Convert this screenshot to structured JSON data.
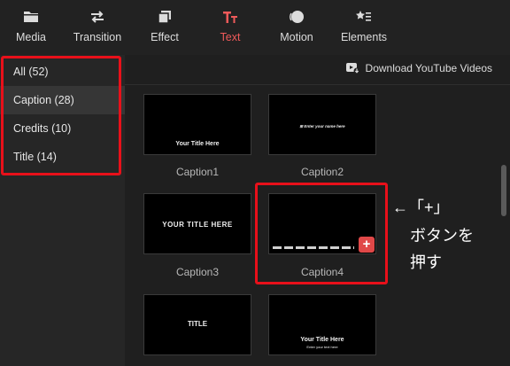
{
  "toolbar": {
    "items": [
      {
        "label": "Media",
        "icon": "folder-icon"
      },
      {
        "label": "Transition",
        "icon": "swap-arrows-icon"
      },
      {
        "label": "Effect",
        "icon": "layers-icon"
      },
      {
        "label": "Text",
        "icon": "text-icon",
        "active": true
      },
      {
        "label": "Motion",
        "icon": "motion-circle-icon"
      },
      {
        "label": "Elements",
        "icon": "shapes-icon"
      }
    ],
    "active_color": "#ef5a5a"
  },
  "sidebar": {
    "items": [
      {
        "label": "All (52)"
      },
      {
        "label": "Caption (28)",
        "selected": true
      },
      {
        "label": "Credits (10)"
      },
      {
        "label": "Title (14)"
      }
    ]
  },
  "content": {
    "download_label": "Download YouTube Videos",
    "thumbs": [
      {
        "name": "Caption1",
        "text": "Your  Title Here"
      },
      {
        "name": "Caption2",
        "text": "Enter your name here"
      },
      {
        "name": "Caption3",
        "text": "YOUR TITLE HERE"
      },
      {
        "name": "Caption4",
        "text": "",
        "add_label": "+"
      },
      {
        "name": "",
        "text": "TITLE"
      },
      {
        "name": "",
        "text": "Your  Title Here",
        "subtext": "Enter your text here"
      }
    ]
  },
  "annotation": {
    "line1": "←「+」",
    "line2": "ボタンを",
    "line3": "押す",
    "highlight_color": "#e8101a"
  }
}
